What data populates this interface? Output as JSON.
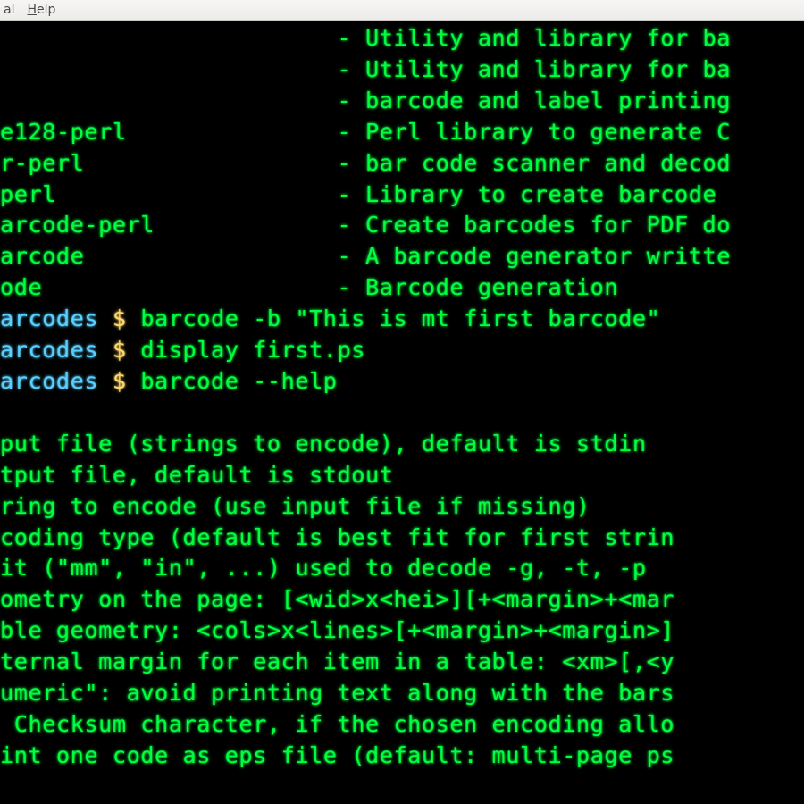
{
  "menubar": {
    "terminal_tail": "al",
    "help": "Help"
  },
  "terminal": {
    "pkg_col_start": 24,
    "packages": [
      {
        "name": "",
        "desc": "Utility and library for ba"
      },
      {
        "name": "",
        "desc": "Utility and library for ba"
      },
      {
        "name": "",
        "desc": "barcode and label printing"
      },
      {
        "name": "e128-perl",
        "desc": "Perl library to generate C"
      },
      {
        "name": "r-perl",
        "desc": "bar code scanner and decod"
      },
      {
        "name": "perl",
        "desc": "Library to create barcode "
      },
      {
        "name": "arcode-perl",
        "desc": "Create barcodes for PDF do"
      },
      {
        "name": "arcode",
        "desc": "A barcode generator writte"
      },
      {
        "name": "ode",
        "desc": "Barcode generation"
      }
    ],
    "prompts": [
      {
        "prefix": "arcodes ",
        "cmd": "barcode -b \"This is mt first barcode\" "
      },
      {
        "prefix": "arcodes ",
        "cmd": "display first.ps"
      },
      {
        "prefix": "arcodes ",
        "cmd": "barcode --help"
      }
    ],
    "help_output": [
      "put file (strings to encode), default is stdin",
      "tput file, default is stdout",
      "ring to encode (use input file if missing)",
      "coding type (default is best fit for first strin",
      "it (\"mm\", \"in\", ...) used to decode -g, -t, -p",
      "ometry on the page: [<wid>x<hei>][+<margin>+<mar",
      "ble geometry: <cols>x<lines>[+<margin>+<margin>]",
      "ternal margin for each item in a table: <xm>[,<y",
      "umeric\": avoid printing text along with the bars",
      " Checksum character, if the chosen encoding allo",
      "int one code as eps file (default: multi-page ps"
    ]
  }
}
